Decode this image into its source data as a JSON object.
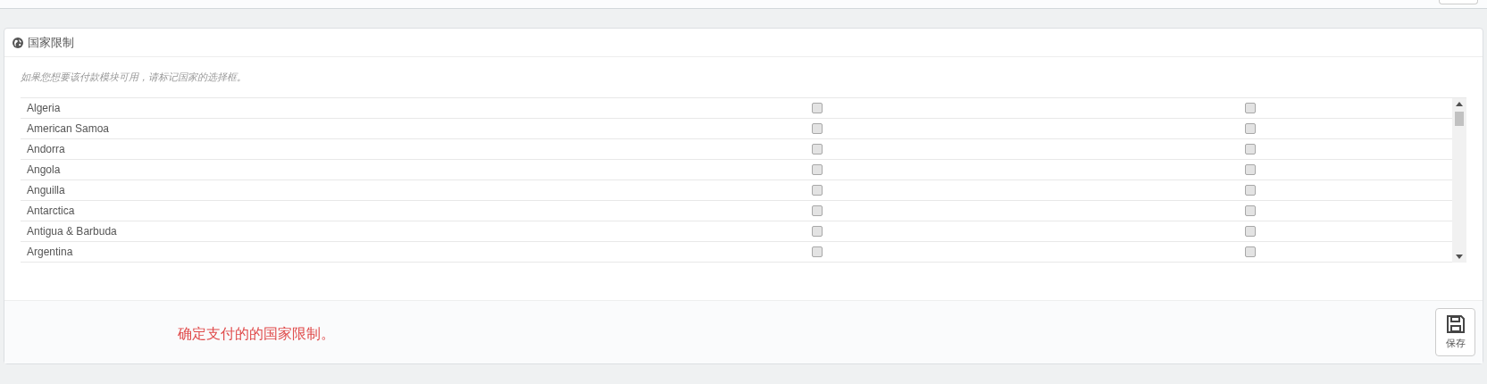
{
  "panel": {
    "title": "国家限制",
    "hint": "如果您想要该付款模块可用，请标记国家的选择框。"
  },
  "countries": [
    {
      "name": "Algeria",
      "checks": [
        false,
        false
      ]
    },
    {
      "name": "American Samoa",
      "checks": [
        false,
        false
      ]
    },
    {
      "name": "Andorra",
      "checks": [
        false,
        false
      ]
    },
    {
      "name": "Angola",
      "checks": [
        false,
        false
      ]
    },
    {
      "name": "Anguilla",
      "checks": [
        false,
        false
      ]
    },
    {
      "name": "Antarctica",
      "checks": [
        false,
        false
      ]
    },
    {
      "name": "Antigua & Barbuda",
      "checks": [
        false,
        false
      ]
    },
    {
      "name": "Argentina",
      "checks": [
        false,
        false
      ]
    }
  ],
  "footer": {
    "note": "确定支付的的国家限制。",
    "save_label": "保存"
  }
}
